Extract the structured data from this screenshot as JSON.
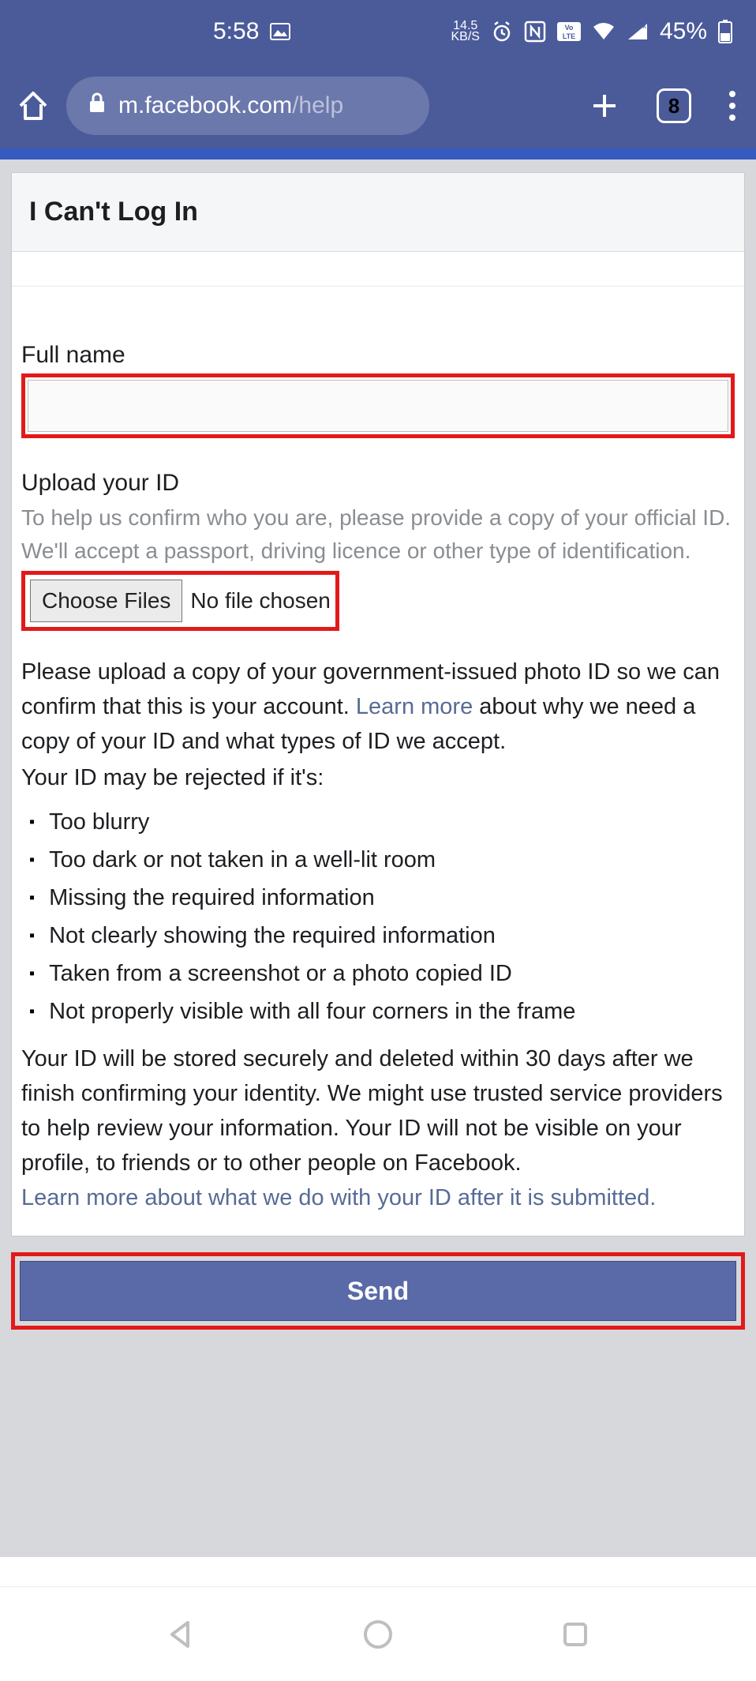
{
  "status": {
    "time": "5:58",
    "kbs_value": "14.5",
    "kbs_unit": "KB/S",
    "battery": "45%",
    "tab_count": "8"
  },
  "url": {
    "domain": "m.facebook.com",
    "path": "/help"
  },
  "page": {
    "title": "I Can't Log In",
    "full_name_label": "Full name",
    "upload_label": "Upload your ID",
    "upload_help": "To help us confirm who you are, please provide a copy of your official ID. We'll accept a passport, driving licence or other type of identification.",
    "choose_files": "Choose Files",
    "no_file": "No file chosen",
    "desc_part1": "Please upload a copy of your government-issued photo ID so we can confirm that this is your account. ",
    "learn_more": "Learn more",
    "desc_part2": " about why we need a copy of your ID and what types of ID we accept.",
    "reject_intro": "Your ID may be rejected if it's:",
    "reject_list": [
      "Too blurry",
      "Too dark or not taken in a well-lit room",
      "Missing the required information",
      "Not clearly showing the required information",
      "Taken from a screenshot or a photo copied ID",
      "Not properly visible with all four corners in the frame"
    ],
    "storage_text": "Your ID will be stored securely and deleted within 30 days after we finish confirming your identity. We might use trusted service providers to help review your information. Your ID will not be visible on your profile, to friends or to other people on Facebook.",
    "learn_more_2": "Learn more about what we do with your ID after it is submitted.",
    "send": "Send"
  }
}
